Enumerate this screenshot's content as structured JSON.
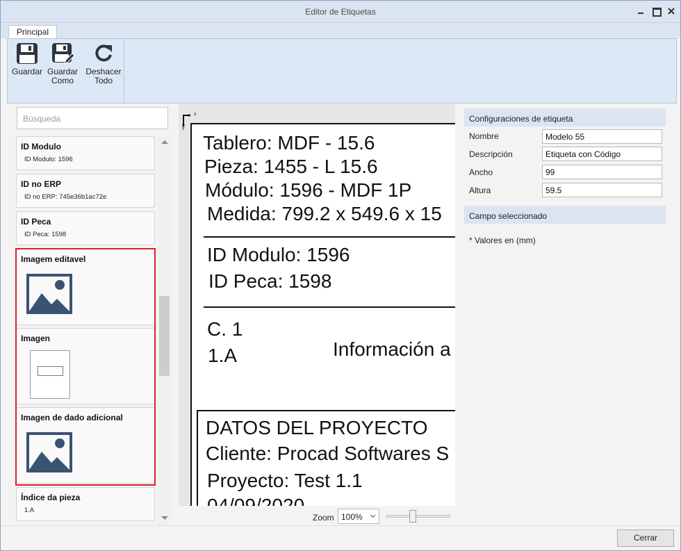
{
  "window": {
    "title": "Editor de Etiquetas"
  },
  "ribbon": {
    "tab": "Principal",
    "buttons": [
      {
        "line1": "Guardar",
        "line2": "",
        "icon": "save-icon"
      },
      {
        "line1": "Guardar",
        "line2": "Como",
        "icon": "save-as-icon"
      },
      {
        "line1": "Deshacer",
        "line2": "Todo",
        "icon": "undo-all-icon"
      }
    ]
  },
  "fields": {
    "search_placeholder": "Búsqueda",
    "items": [
      {
        "title": "ID Modulo",
        "value": "ID Modulo: 1596"
      },
      {
        "title": "ID no ERP",
        "value": "ID no ERP: 745e36b1ac72e"
      },
      {
        "title": "ID Peca",
        "value": "ID Peca: 1598"
      },
      {
        "title": "Imagem editavel",
        "icon": "image-icon"
      },
      {
        "title": "Imagen",
        "icon": "drawing-thumbnail"
      },
      {
        "title": "Imagen de dado adicional",
        "icon": "image-icon"
      },
      {
        "title": "Índice da pieza",
        "value": "1.A"
      }
    ]
  },
  "label_preview": {
    "lines": [
      "Tablero: MDF - 15.6",
      "Pieza: 1455 - L 15.6",
      "Módulo: 1596 - MDF 1P",
      "Medida: 799.2 x 549.6 x 15",
      "ID Modulo: 1596",
      "ID Peca: 1598",
      "C. 1",
      "1.A",
      "Información a",
      "DATOS DEL PROYECTO",
      "Cliente: Procad Softwares S",
      "Proyecto: Test 1.1",
      "04/09/2020"
    ],
    "axis_x": "x",
    "axis_y": "y"
  },
  "zoom": {
    "label": "Zoom",
    "value": "100%",
    "slider_fraction": 0.4
  },
  "properties": {
    "section_label": "Configuraciones de etiqueta",
    "nombre_label": "Nombre",
    "nombre_value": "Modelo 55",
    "descripcion_label": "Descripción",
    "descripcion_value": "Etiqueta con Código",
    "ancho_label": "Ancho",
    "ancho_value": "99",
    "altura_label": "Altura",
    "altura_value": "59.5",
    "selected_section": "Campo seleccionado",
    "note": "* Valores en (mm)"
  },
  "footer": {
    "close_label": "Cerrar"
  },
  "colors": {
    "selection": "#d8232a",
    "image_icon": "#3b5373",
    "ribbon": "#dde8f6"
  }
}
